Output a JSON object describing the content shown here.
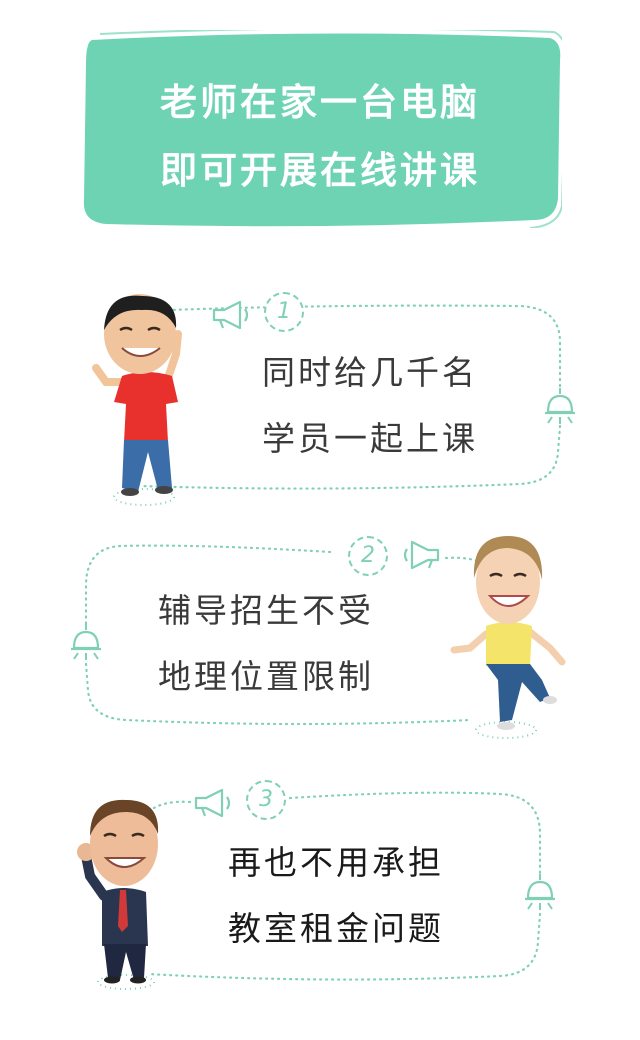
{
  "banner": {
    "line1": "老师在家一台电脑",
    "line2": "即可开展在线讲课",
    "color": "#6dd3b3"
  },
  "features": [
    {
      "number": "1",
      "line1": "同时给几千名",
      "line2": "学员一起上课"
    },
    {
      "number": "2",
      "line1": "辅导招生不受",
      "line2": "地理位置限制"
    },
    {
      "number": "3",
      "line1": "再也不用承担",
      "line2": "教室租金问题"
    }
  ],
  "colors": {
    "accent": "#7fd0b5",
    "banner": "#6dd3b3",
    "text": "#3a3a3a"
  },
  "icons": [
    "megaphone-icon",
    "lamp-icon"
  ]
}
